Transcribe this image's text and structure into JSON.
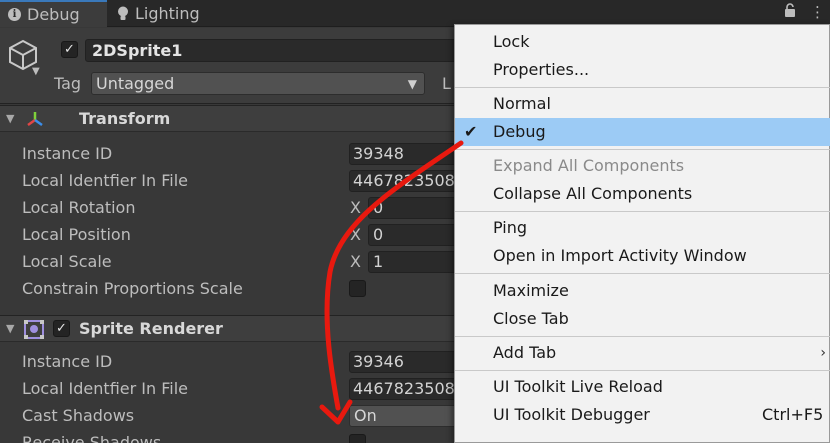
{
  "tabs": [
    {
      "label": "Debug",
      "icon": "info-icon",
      "active": true
    },
    {
      "label": "Lighting",
      "icon": "lightbulb-icon",
      "active": false
    }
  ],
  "header": {
    "object_name": "2DSprite1",
    "active_checked": true,
    "tag_label": "Tag",
    "tag_value": "Untagged",
    "layer_label_partial": "L"
  },
  "transform": {
    "title": "Transform",
    "rows": [
      {
        "label": "Instance ID",
        "value": "39348"
      },
      {
        "label": "Local Identfier In File",
        "value": "4467823508"
      },
      {
        "label": "Local Rotation",
        "axis": "X",
        "value": "0"
      },
      {
        "label": "Local Position",
        "axis": "X",
        "value": "0"
      },
      {
        "label": "Local Scale",
        "axis": "X",
        "value": "1"
      },
      {
        "label": "Constrain Proportions Scale",
        "checked": false
      }
    ]
  },
  "sprite_renderer": {
    "title": "Sprite Renderer",
    "enabled": true,
    "rows": [
      {
        "label": "Instance ID",
        "value": "39346"
      },
      {
        "label": "Local Identfier In File",
        "value": "4467823508"
      },
      {
        "label": "Cast Shadows",
        "value": "On"
      },
      {
        "label": "Receive Shadows",
        "checked": false
      }
    ]
  },
  "menu": {
    "items": [
      {
        "label": "Lock"
      },
      {
        "label": "Properties..."
      },
      {
        "label": "Normal"
      },
      {
        "label": "Debug",
        "checked": true,
        "selected": true
      },
      {
        "label": "Expand All Components",
        "disabled": true
      },
      {
        "label": "Collapse All Components"
      },
      {
        "label": "Ping"
      },
      {
        "label": "Open in Import Activity Window"
      },
      {
        "label": "Maximize"
      },
      {
        "label": "Close Tab"
      },
      {
        "label": "Add Tab",
        "submenu": true
      },
      {
        "label": "UI Toolkit Live Reload"
      },
      {
        "label": "UI Toolkit Debugger",
        "shortcut": "Ctrl+F5"
      }
    ]
  },
  "colors": {
    "selection": "#9ccbf5",
    "annotation_arrow": "#e8190f",
    "active_tab_accent": "#3a79bb"
  }
}
